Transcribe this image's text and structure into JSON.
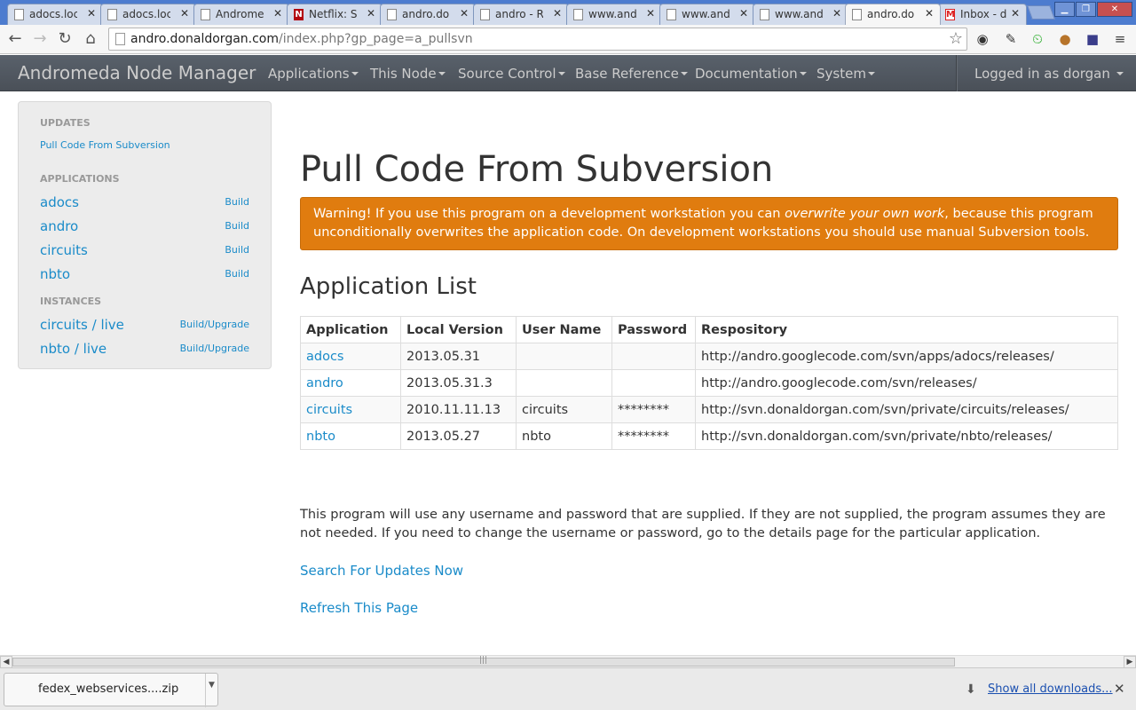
{
  "browser": {
    "tabs": [
      {
        "label": "adocs.loc",
        "icon": "page-icon"
      },
      {
        "label": "adocs.loc",
        "icon": "page-icon"
      },
      {
        "label": "Androme",
        "icon": "page-icon"
      },
      {
        "label": "Netflix: Se",
        "icon": "netflix-icon"
      },
      {
        "label": "andro.do",
        "icon": "page-icon"
      },
      {
        "label": "andro - R",
        "icon": "page-icon"
      },
      {
        "label": "www.and",
        "icon": "page-icon"
      },
      {
        "label": "www.and",
        "icon": "page-icon"
      },
      {
        "label": "www.and",
        "icon": "page-icon"
      },
      {
        "label": "andro.do",
        "icon": "page-icon",
        "active": true
      },
      {
        "label": "Inbox - d",
        "icon": "gmail-icon"
      }
    ],
    "url_host": "andro.donaldorgan.com",
    "url_path": "/index.php?gp_page=a_pullsvn"
  },
  "navbar": {
    "brand": "Andromeda Node Manager",
    "menus": [
      "Applications",
      "This Node",
      "Source Control",
      "Base Reference",
      "Documentation",
      "System"
    ],
    "user": "Logged in as dorgan"
  },
  "sidebar": {
    "updates_header": "UPDATES",
    "updates_link": "Pull Code From Subversion",
    "applications_header": "APPLICATIONS",
    "applications": [
      {
        "name": "adocs",
        "action": "Build"
      },
      {
        "name": "andro",
        "action": "Build"
      },
      {
        "name": "circuits",
        "action": "Build"
      },
      {
        "name": "nbto",
        "action": "Build"
      }
    ],
    "instances_header": "INSTANCES",
    "instances": [
      {
        "name": "circuits / live",
        "action": "Build/Upgrade"
      },
      {
        "name": "nbto / live",
        "action": "Build/Upgrade"
      }
    ]
  },
  "main": {
    "title": "Pull Code From Subversion",
    "warning_prefix": "Warning! If you use this program on a development workstation you can ",
    "warning_emph": "overwrite your own work",
    "warning_suffix": ", because this program unconditionally overwrites the application code. On development workstations you should use manual Subversion tools.",
    "list_title": "Application List",
    "table_headers": [
      "Application",
      "Local Version",
      "User Name",
      "Password",
      "Respository"
    ],
    "rows": [
      {
        "app": "adocs",
        "version": "2013.05.31",
        "user": "",
        "password": "",
        "repo": "http://andro.googlecode.com/svn/apps/adocs/releases/"
      },
      {
        "app": "andro",
        "version": "2013.05.31.3",
        "user": "",
        "password": "",
        "repo": "http://andro.googlecode.com/svn/releases/"
      },
      {
        "app": "circuits",
        "version": "2010.11.11.13",
        "user": "circuits",
        "password": "********",
        "repo": "http://svn.donaldorgan.com/svn/private/circuits/releases/"
      },
      {
        "app": "nbto",
        "version": "2013.05.27",
        "user": "nbto",
        "password": "********",
        "repo": "http://svn.donaldorgan.com/svn/private/nbto/releases/"
      }
    ],
    "note": "This program will use any username and password that are supplied. If they are not supplied, the program assumes they are not needed. If you need to change the username or password, go to the details page for the particular application.",
    "search_link": "Search For Updates Now",
    "refresh_link": "Refresh This Page"
  },
  "downloads": {
    "file": "fedex_webservices....zip",
    "show_all": "Show all downloads..."
  }
}
